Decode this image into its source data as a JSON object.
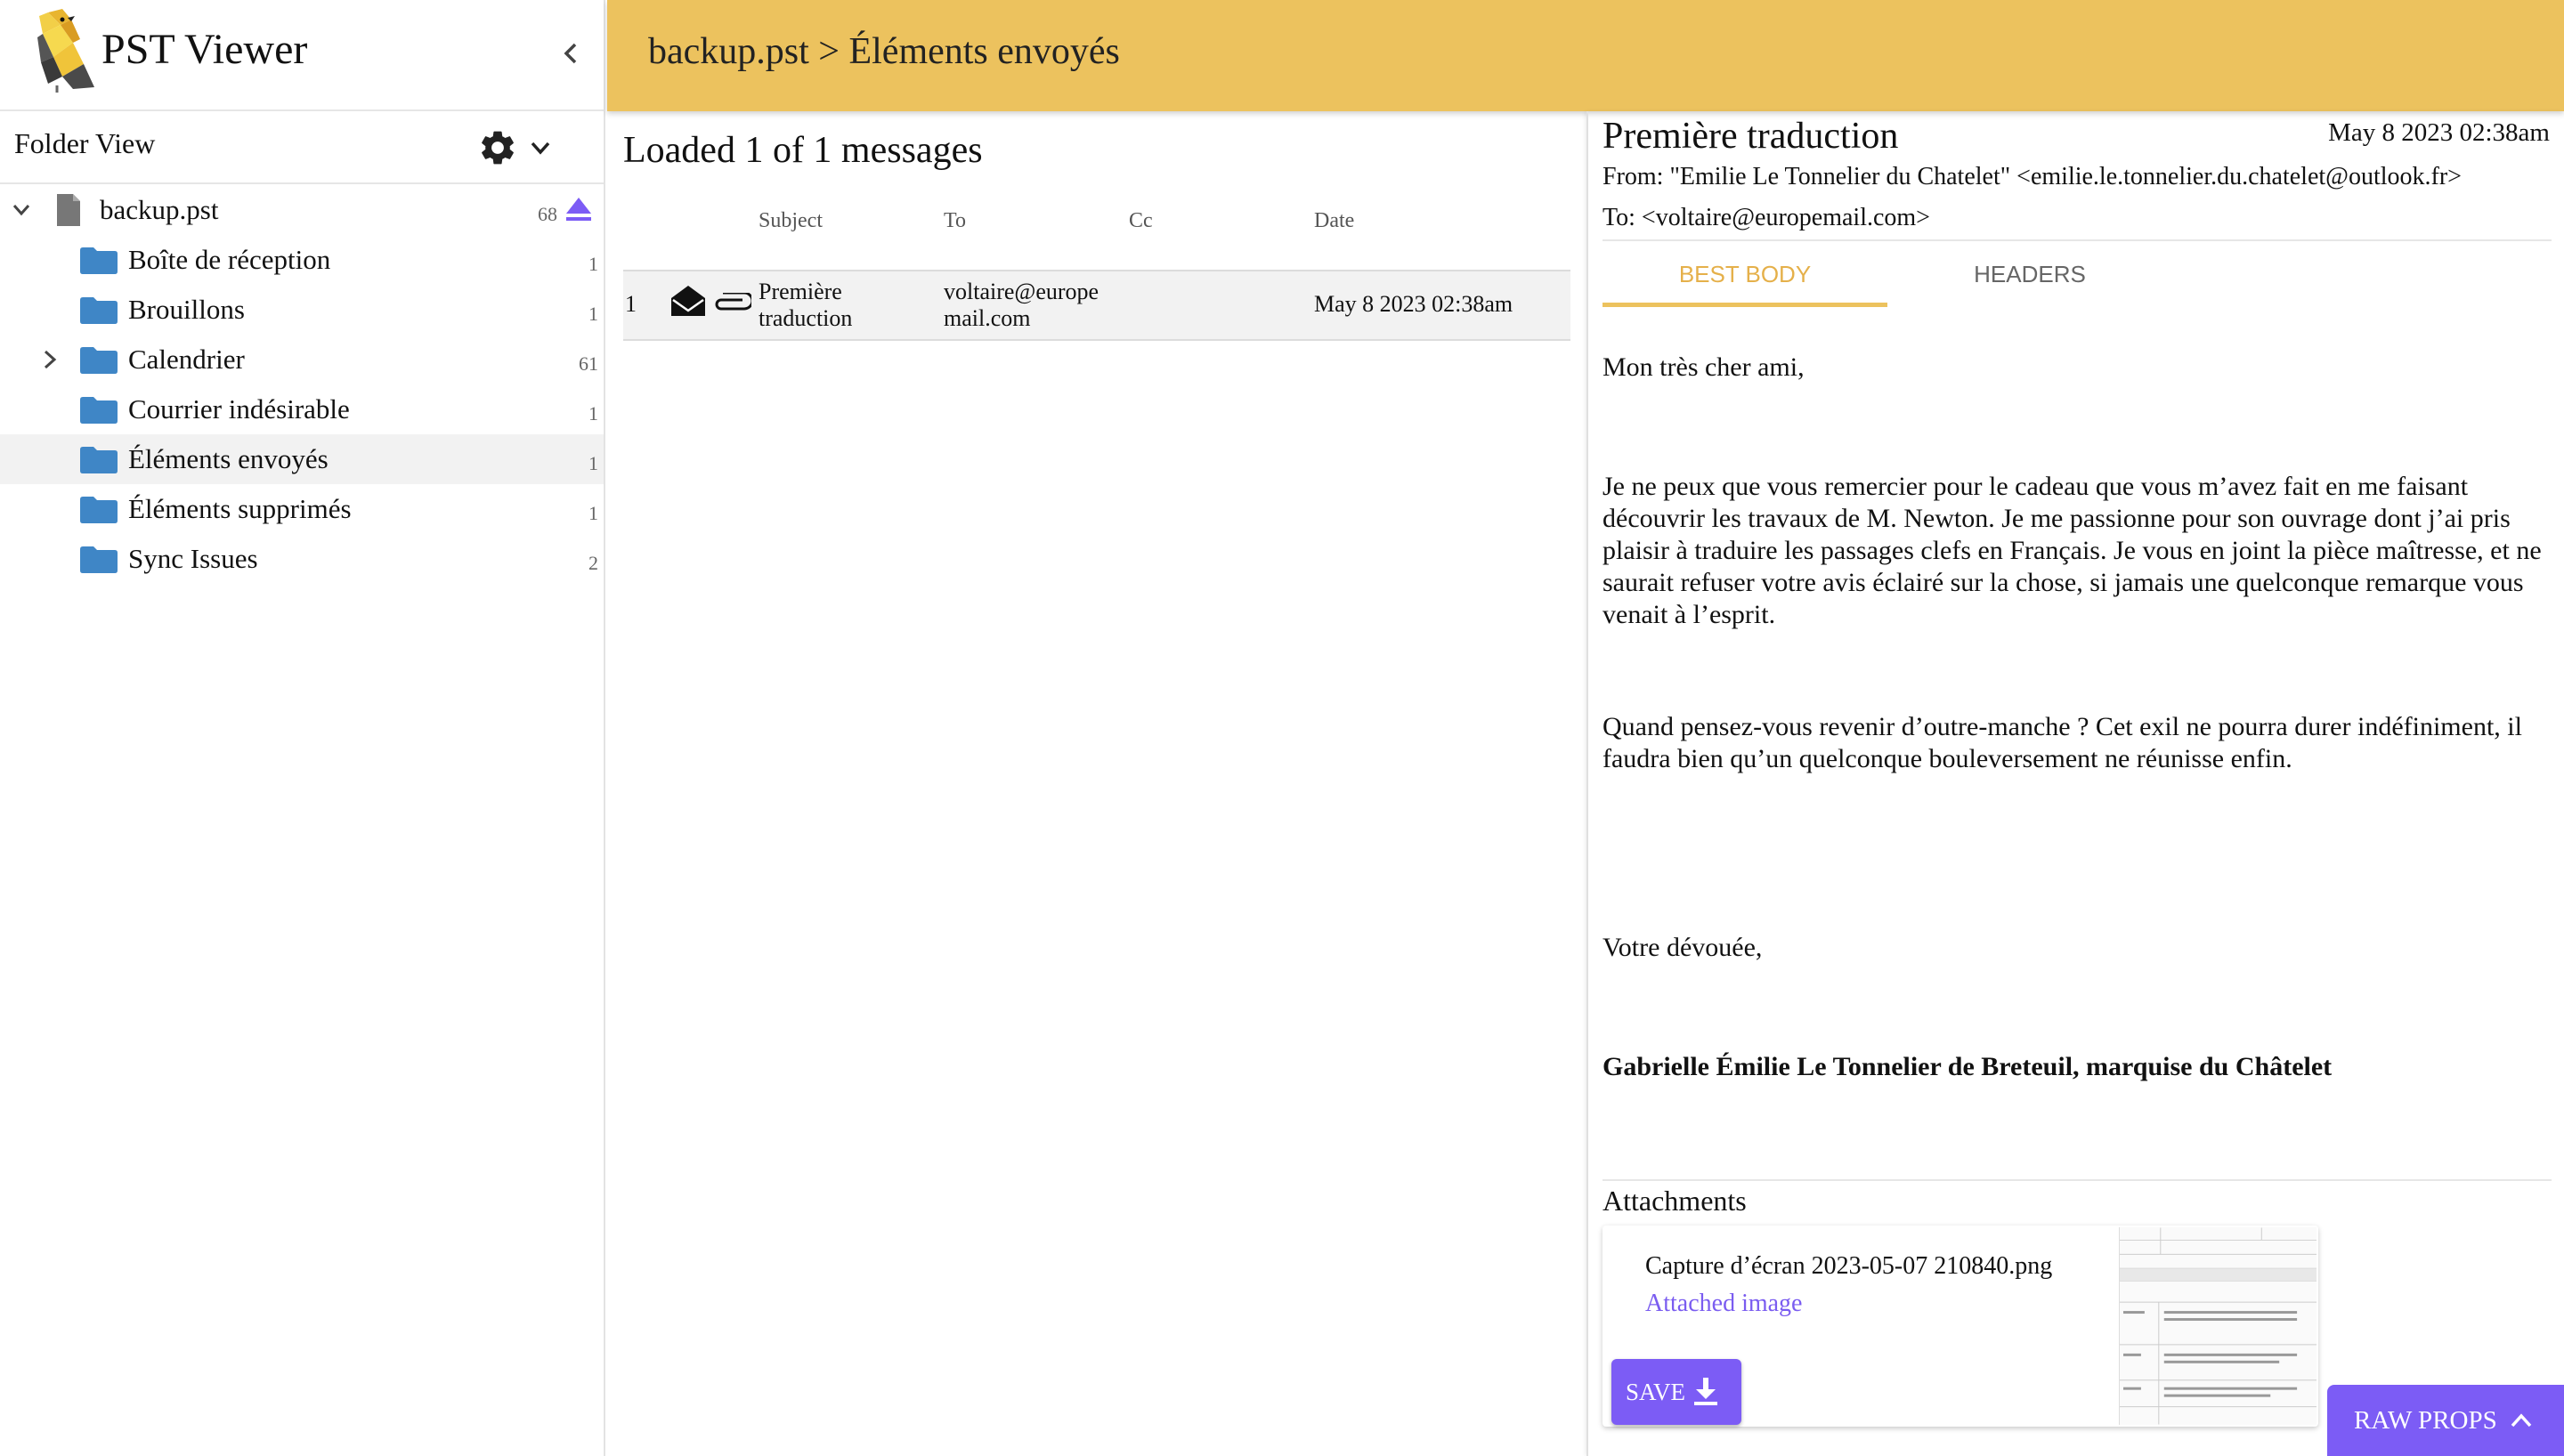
{
  "app": {
    "title": "PST Viewer"
  },
  "sidebar": {
    "folder_view_label": "Folder View",
    "root": {
      "label": "backup.pst",
      "count": "68"
    },
    "folders": [
      {
        "label": "Boîte de réception",
        "count": "1"
      },
      {
        "label": "Brouillons",
        "count": "1"
      },
      {
        "label": "Calendrier",
        "count": "61"
      },
      {
        "label": "Courrier indésirable",
        "count": "1"
      },
      {
        "label": "Éléments envoyés",
        "count": "1"
      },
      {
        "label": "Éléments supprimés",
        "count": "1"
      },
      {
        "label": "Sync Issues",
        "count": "2"
      }
    ],
    "selected_folder": "Éléments envoyés"
  },
  "header": {
    "breadcrumb": "backup.pst > Éléments envoyés"
  },
  "message_list": {
    "status": "Loaded 1 of 1 messages",
    "columns": [
      "Subject",
      "To",
      "Cc",
      "Date"
    ],
    "rows": [
      {
        "index": "1",
        "subject_line1": "Première",
        "subject_line2": "traduction",
        "to_line1": "voltaire@europe",
        "to_line2": "mail.com",
        "cc": "",
        "date": "May 8 2023 02:38am"
      }
    ]
  },
  "message": {
    "subject": "Première traduction",
    "date": "May 8 2023 02:38am",
    "from": "From: \"Emilie Le Tonnelier du Chatelet\" <emilie.le.tonnelier.du.chatelet@outlook.fr>",
    "to": "To: <voltaire@europemail.com>",
    "tabs": [
      "BEST BODY",
      "HEADERS"
    ],
    "active_tab": "BEST BODY",
    "body": {
      "greeting": "Mon très cher ami,",
      "para1": "Je ne peux que vous remercier pour le cadeau que vous m’avez fait en me faisant découvrir les travaux de M. Newton. Je me passionne pour son ouvrage dont j’ai pris plaisir à traduire les passages clefs en Français. Je vous en joint la pièce maîtresse, et ne saurait refuser votre avis éclairé sur la chose, si jamais une quelconque remarque vous venait à l’esprit.",
      "para2": "Quand pensez-vous revenir d’outre-manche ? Cet exil ne pourra durer indéfiniment, il faudra bien qu’un quelconque bouleversement ne réunisse enfin.",
      "closing": "Votre dévouée,",
      "signature": "Gabrielle Émilie Le Tonnelier de Breteuil, marquise du Châtelet"
    },
    "attachments_title": "Attachments",
    "attachment": {
      "name": "Capture d’écran 2023-05-07 210840.png",
      "type": "Attached image",
      "save_label": "SAVE"
    }
  },
  "raw_props_label": "RAW PROPS",
  "colors": {
    "header_bg": "#ecc25e",
    "accent_purple": "#7c5cf5",
    "folder_blue": "#3f86c6"
  },
  "icons": [
    "logo-bird-icon",
    "chevron-left-icon",
    "gear-icon",
    "chevron-down-icon",
    "chevron-right-icon",
    "file-icon",
    "eject-icon",
    "folder-icon",
    "envelope-open-icon",
    "paperclip-icon",
    "download-icon",
    "chevron-up-icon"
  ]
}
